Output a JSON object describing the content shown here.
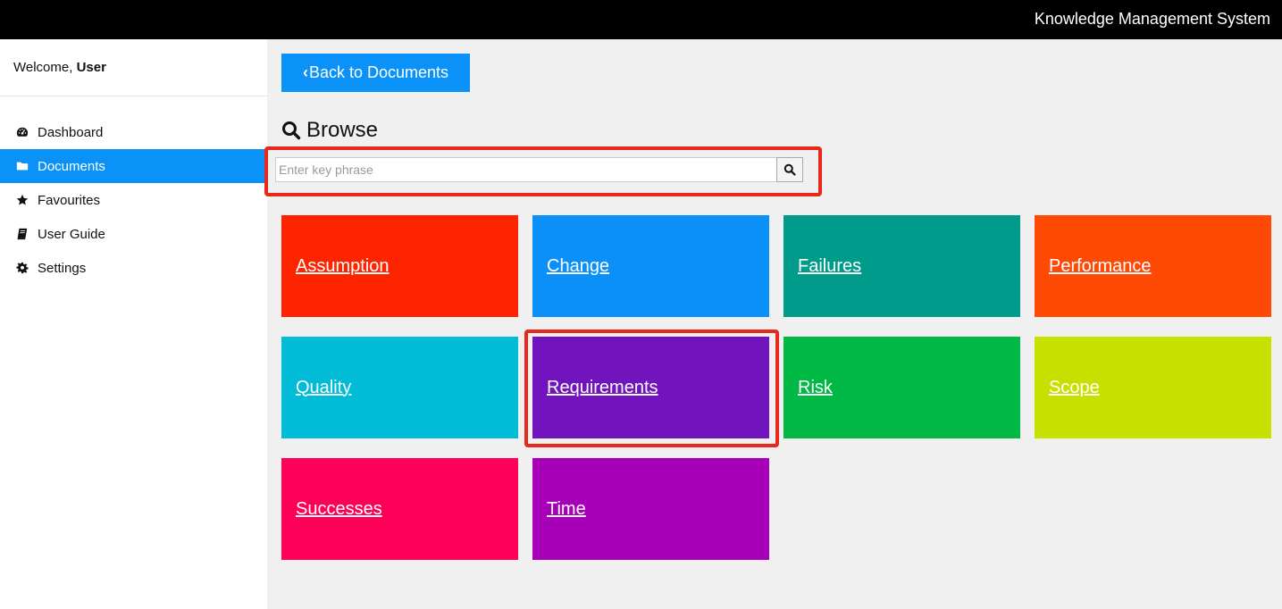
{
  "app": {
    "title": "Knowledge Management System"
  },
  "sidebar": {
    "welcome_prefix": "Welcome,",
    "welcome_user": "User",
    "items": [
      {
        "label": "Dashboard",
        "icon": "dashboard-icon",
        "active": false
      },
      {
        "label": "Documents",
        "icon": "folder-icon",
        "active": true
      },
      {
        "label": "Favourites",
        "icon": "star-icon",
        "active": false
      },
      {
        "label": "User Guide",
        "icon": "book-icon",
        "active": false
      },
      {
        "label": "Settings",
        "icon": "gear-icon",
        "active": false
      }
    ]
  },
  "main": {
    "back_button": "Back to Documents",
    "browse_title": "Browse",
    "search": {
      "placeholder": "Enter key phrase",
      "value": ""
    },
    "tiles": [
      {
        "label": "Assumption",
        "color": "#ff2400"
      },
      {
        "label": "Change",
        "color": "#0b8ff8"
      },
      {
        "label": "Failures",
        "color": "#009b8b"
      },
      {
        "label": "Performance",
        "color": "#ff4a06"
      },
      {
        "label": "Quality",
        "color": "#00bcd7"
      },
      {
        "label": "Requirements",
        "color": "#7214be"
      },
      {
        "label": "Risk",
        "color": "#00b844"
      },
      {
        "label": "Scope",
        "color": "#c8e000"
      },
      {
        "label": "Successes",
        "color": "#ff0058"
      },
      {
        "label": "Time",
        "color": "#a800b8"
      }
    ]
  },
  "colors": {
    "accent": "#0b92f8",
    "highlight": "#e8281d",
    "topbar": "#000000"
  }
}
